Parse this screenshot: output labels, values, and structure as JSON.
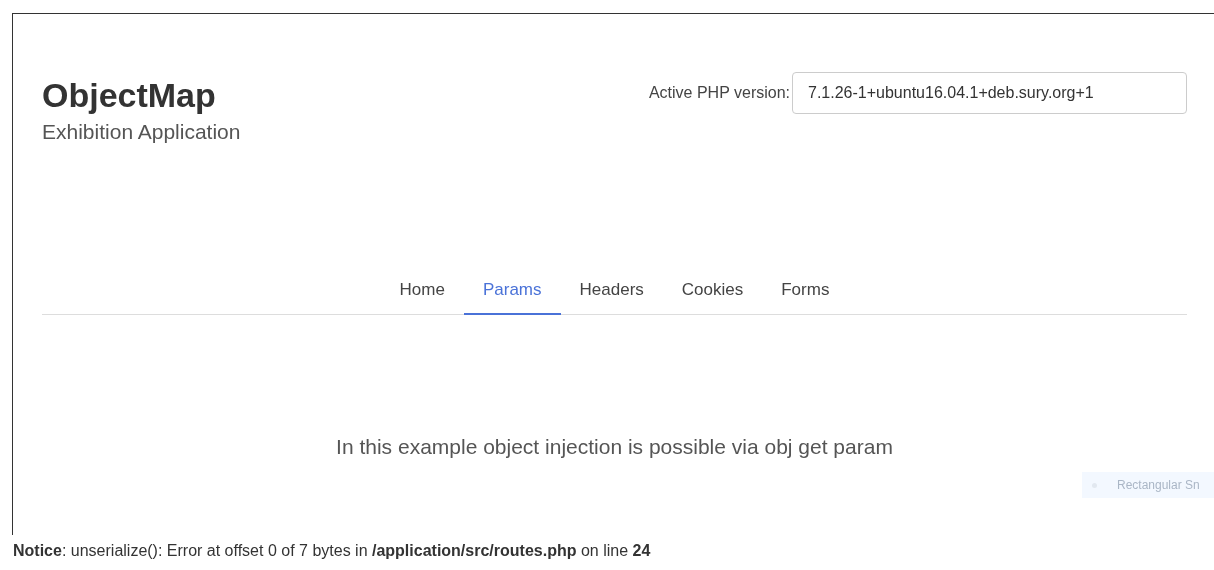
{
  "header": {
    "title": "ObjectMap",
    "subtitle": "Exhibition Application"
  },
  "php_version": {
    "label": "Active PHP version:",
    "value": "7.1.26-1+ubuntu16.04.1+deb.sury.org+1"
  },
  "tabs": [
    {
      "label": "Home",
      "selected": false
    },
    {
      "label": "Params",
      "selected": true
    },
    {
      "label": "Headers",
      "selected": false
    },
    {
      "label": "Cookies",
      "selected": false
    },
    {
      "label": "Forms",
      "selected": false
    }
  ],
  "content": {
    "message": "In this example object injection is possible via obj get param"
  },
  "overlay": {
    "label": "Rectangular Sn"
  },
  "notice": "**Notice**: unserialize(): Error at offset 0 of 7 bytes in **/application/src/routes.php** on line **24**"
}
